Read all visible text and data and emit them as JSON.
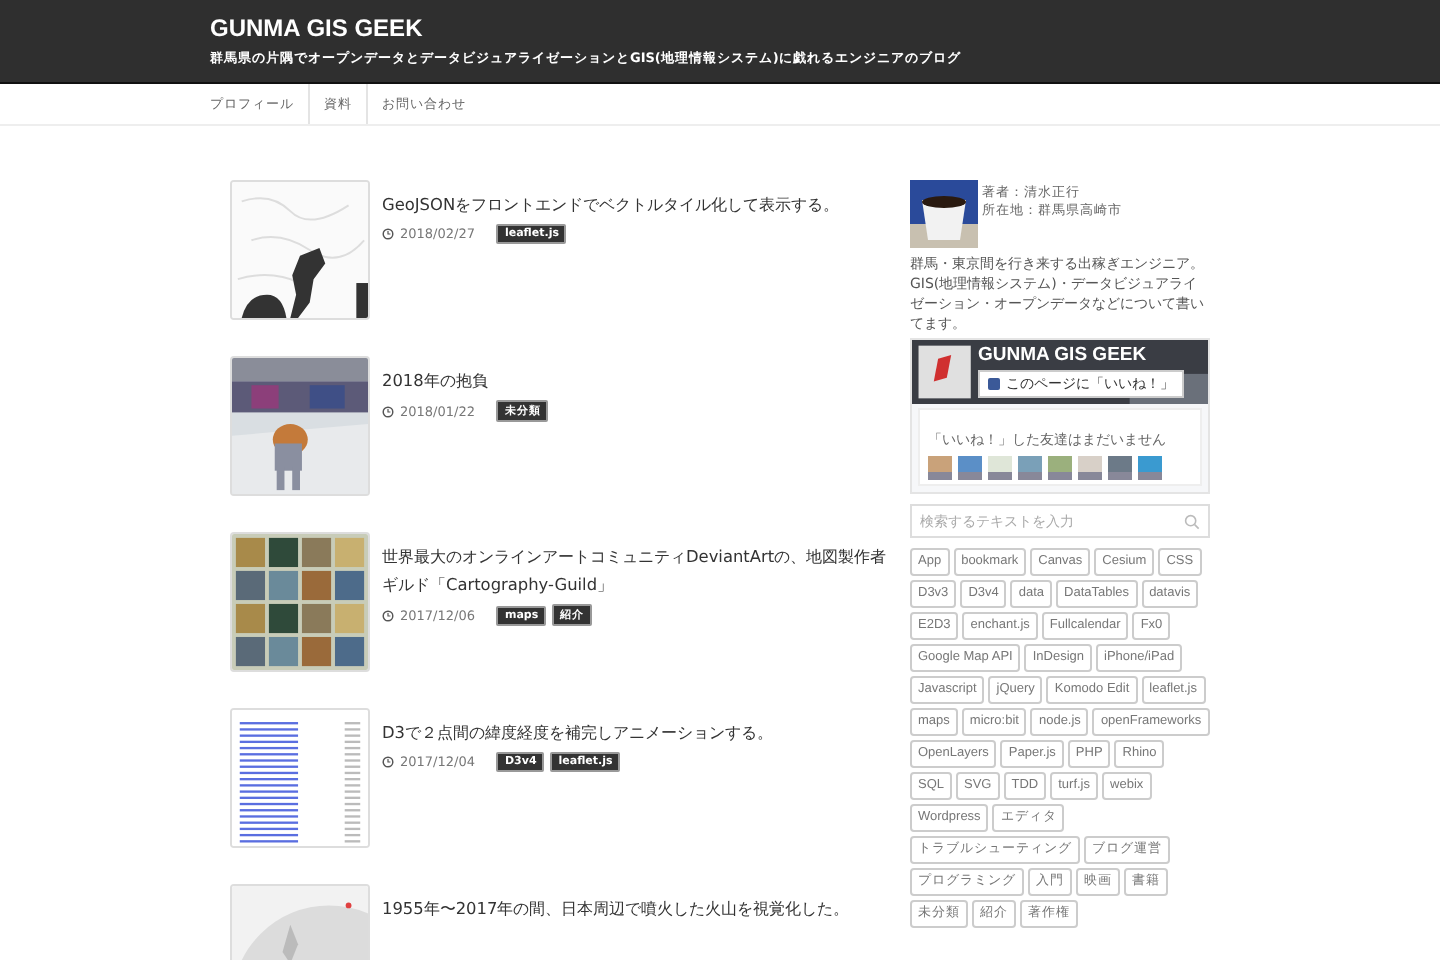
{
  "site": {
    "title": "GUNMA GIS GEEK",
    "tagline": "群馬県の片隅でオープンデータとデータビジュアライゼーションとGIS(地理情報システム)に戯れるエンジニアのブログ"
  },
  "nav": [
    "プロフィール",
    "資料",
    "お問い合わせ"
  ],
  "posts": [
    {
      "title": "GeoJSONをフロントエンドでベクトルタイル化して表示する。",
      "date": "2018/02/27",
      "tags": [
        "leaflet.js"
      ]
    },
    {
      "title": "2018年の抱負",
      "date": "2018/01/22",
      "tags": [
        "未分類"
      ]
    },
    {
      "title": "世界最大のオンラインアートコミュニティDeviantArtの、地図製作者ギルド「Cartography-Guild」",
      "date": "2017/12/06",
      "tags": [
        "maps",
        "紹介"
      ]
    },
    {
      "title": "D3で２点間の緯度経度を補完しアニメーションする。",
      "date": "2017/12/04",
      "tags": [
        "D3v4",
        "leaflet.js"
      ]
    },
    {
      "title": "1955年〜2017年の間、日本周辺で噴火した火山を視覚化した。"
    }
  ],
  "author": {
    "name": "著者：清水正行",
    "location": "所在地：群馬県高崎市",
    "bio": "群馬・東京間を行き来する出稼ぎエンジニア。GIS(地理情報システム)・データビジュアライゼーション・オープンデータなどについて書いてます。"
  },
  "facebook": {
    "page_title": "GUNMA GIS GEEK",
    "like_button": "このページに「いいね！」",
    "friends_note": "「いいね！」した友達はまだいません"
  },
  "search": {
    "placeholder": "検索するテキストを入力"
  },
  "tags": [
    "App",
    "bookmark",
    "Canvas",
    "Cesium",
    "CSS",
    "D3v3",
    "D3v4",
    "data",
    "DataTables",
    "datavis",
    "E2D3",
    "enchant.js",
    "Fullcalendar",
    "Fx0",
    "Google Map API",
    "InDesign",
    "iPhone/iPad",
    "Javascript",
    "jQuery",
    "Komodo Edit",
    "leaflet.js",
    "maps",
    "micro:bit",
    "node.js",
    "openFrameworks",
    "OpenLayers",
    "Paper.js",
    "PHP",
    "Rhino",
    "SQL",
    "SVG",
    "TDD",
    "turf.js",
    "webix",
    "Wordpress",
    "エディタ",
    "トラブルシューティング",
    "ブログ運営",
    "プログラミング",
    "入門",
    "映画",
    "書籍",
    "未分類",
    "紹介",
    "著作権"
  ]
}
